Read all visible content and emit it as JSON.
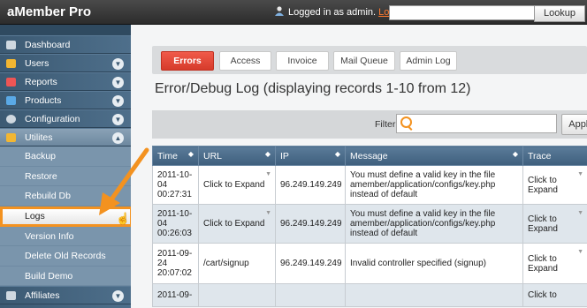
{
  "header": {
    "app_title": "aMember Pro",
    "logged_in_text": "Logged in as admin.",
    "logout_label": "Logout",
    "search_placeholder": "",
    "lookup_label": "Lookup"
  },
  "sidebar": {
    "items": [
      {
        "label": "Dashboard",
        "icon": "monitor-icon",
        "color": "#cfd8e0"
      },
      {
        "label": "Users",
        "icon": "users-icon",
        "color": "#f2b632"
      },
      {
        "label": "Reports",
        "icon": "chart-icon",
        "color": "#e55"
      },
      {
        "label": "Products",
        "icon": "box-icon",
        "color": "#5aa9e6"
      },
      {
        "label": "Configuration",
        "icon": "gear-icon",
        "color": "#cfd8e0"
      },
      {
        "label": "Utilites",
        "icon": "wrench-icon",
        "color": "#f2b632"
      }
    ],
    "sub_items": [
      "Backup",
      "Restore",
      "Rebuild Db",
      "Logs",
      "Version Info",
      "Delete Old Records",
      "Build Demo"
    ],
    "bottom_item": {
      "label": "Affiliates",
      "icon": "affiliates-icon"
    }
  },
  "tabs": [
    "Errors",
    "Access",
    "Invoice",
    "Mail Queue",
    "Admin Log"
  ],
  "active_tab": "Errors",
  "page_title": "Error/Debug Log (displaying records 1-10 from 12)",
  "filter": {
    "label": "Filter",
    "value": "",
    "apply_label": "Apply"
  },
  "table": {
    "columns": [
      "Time",
      "URL",
      "IP",
      "Message",
      "Trace"
    ],
    "rows": [
      {
        "time": "2011-10-04 00:27:31",
        "url": "Click to Expand",
        "ip": "96.249.149.249",
        "message": "You must define a valid key in the file amember/application/configs/key.php instead of default",
        "trace": "Click to Expand"
      },
      {
        "time": "2011-10-04 00:26:03",
        "url": "Click to Expand",
        "ip": "96.249.149.249",
        "message": "You must define a valid key in the file amember/application/configs/key.php instead of default",
        "trace": "Click to Expand"
      },
      {
        "time": "2011-09-24 20:07:02",
        "url": "/cart/signup",
        "ip": "96.249.149.249",
        "message": "Invalid controller specified (signup)",
        "trace": "Click to Expand"
      },
      {
        "time": "2011-09-",
        "url": "",
        "ip": "",
        "message": "",
        "trace": "Click to"
      }
    ]
  },
  "colors": {
    "accent": "#f39220",
    "error_tab": "#e04a3a",
    "sidebar": "#3c5a73"
  }
}
